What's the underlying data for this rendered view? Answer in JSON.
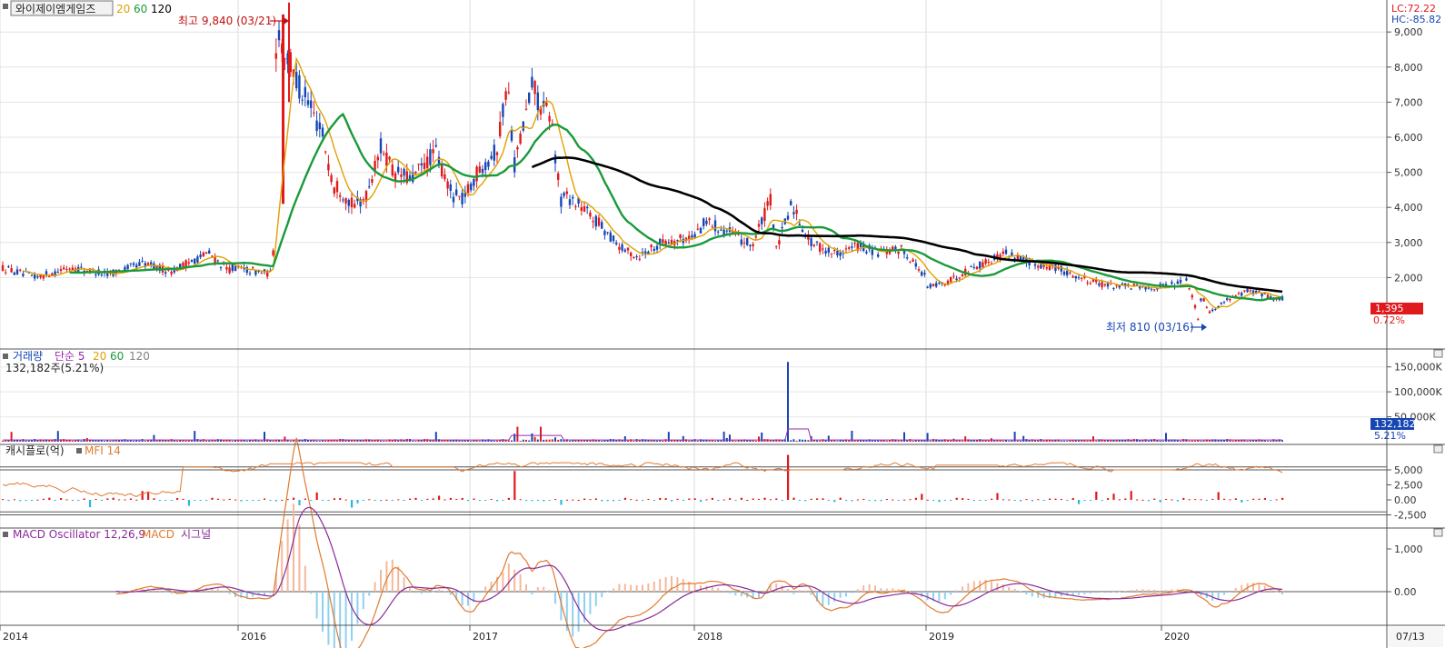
{
  "stock": {
    "name": "와이제이엠게임즈",
    "ma_labels": [
      "20",
      "60",
      "120"
    ],
    "ma_colors": [
      "#e0a000",
      "#1a9a3a",
      "#000000"
    ],
    "lc": "LC:72.22",
    "hc": "HC:-85.82",
    "high_annotation": "최고 9,840 (03/21)",
    "low_annotation": "최저 810 (03/16)",
    "current_price": "1,395",
    "current_change": "0.72%",
    "y_ticks": [
      "9,000",
      "8,000",
      "7,000",
      "6,000",
      "5,000",
      "4,000",
      "3,000",
      "2,000"
    ]
  },
  "volume": {
    "title": "거래량",
    "ma_label": "단순 5",
    "ma_periods": [
      "20",
      "60",
      "120"
    ],
    "ma_colors": [
      "#9a2ab0",
      "#e0a000",
      "#1a9a3a",
      "#808080"
    ],
    "info": "132,182주(5.21%)",
    "current": "132,182",
    "pct": "5.21%",
    "y_ticks": [
      "150,000K",
      "100,000K",
      "50,000K"
    ]
  },
  "cashflow": {
    "title": "캐시플로(억)",
    "mfi_label": "MFI 14",
    "y_ticks": [
      "5,000",
      "2,500",
      "0.00",
      "-2,500"
    ]
  },
  "macd": {
    "title": "MACD Oscillator 12,26,9",
    "macd_label": "MACD",
    "signal_label": "시그널",
    "y_ticks": [
      "1,000",
      "0.00"
    ]
  },
  "x_axis": {
    "labels": [
      "2014",
      "2016",
      "2017",
      "2018",
      "2019",
      "2020"
    ],
    "date_badge": "07/13"
  },
  "colors": {
    "up": "#e0191b",
    "down": "#1646b4",
    "ma20": "#e0a000",
    "ma60": "#1a9a3a",
    "ma120": "#000000",
    "mfi": "#e07a30",
    "cash_up": "#e0191b",
    "cash_down": "#2ab8e0",
    "macd": "#e07a30",
    "signal": "#8a2a9a",
    "osc_up": "#f5b89a",
    "osc_down": "#8fd0f0",
    "price_badge": "#e0191b",
    "volume_badge": "#1646b4"
  },
  "chart_data": [
    {
      "type": "candlestick",
      "title": "와이제이엠게임즈",
      "x_labels": [
        "2014",
        "2016",
        "2017",
        "2018",
        "2019",
        "2020"
      ],
      "ylim": [
        500,
        10000
      ],
      "key_points": [
        {
          "date": "2014",
          "close": 2300
        },
        {
          "date": "2015-06",
          "close": 2200
        },
        {
          "date": "2015-12",
          "close": 2200
        },
        {
          "date": "2016-03",
          "close": 9840,
          "label": "high"
        },
        {
          "date": "2016-06",
          "close": 4500
        },
        {
          "date": "2016-09",
          "close": 5000
        },
        {
          "date": "2017-03",
          "close": 7600
        },
        {
          "date": "2017-06",
          "close": 3600
        },
        {
          "date": "2018-01",
          "close": 3200
        },
        {
          "date": "2018-05",
          "close": 4300
        },
        {
          "date": "2018-09",
          "close": 2800
        },
        {
          "date": "2019-01",
          "close": 2000
        },
        {
          "date": "2019-05",
          "close": 2700
        },
        {
          "date": "2020-03",
          "close": 810,
          "label": "low"
        },
        {
          "date": "2020-07",
          "close": 1395
        }
      ],
      "series": [
        {
          "name": "20"
        },
        {
          "name": "60"
        },
        {
          "name": "120"
        }
      ],
      "current": 1395
    },
    {
      "type": "bar",
      "title": "거래량",
      "ylim": [
        0,
        175000
      ],
      "unit": "K",
      "peak": {
        "date": "2018-05",
        "value": 160000
      },
      "current": 132182
    },
    {
      "type": "bar",
      "title": "캐시플로(억)",
      "ylim": [
        -3500,
        7000
      ],
      "series": [
        {
          "name": "MFI 14"
        }
      ]
    },
    {
      "type": "line",
      "title": "MACD Oscillator 12,26,9",
      "ylim": [
        -500,
        1500
      ],
      "series": [
        {
          "name": "MACD"
        },
        {
          "name": "시그널"
        }
      ]
    }
  ]
}
